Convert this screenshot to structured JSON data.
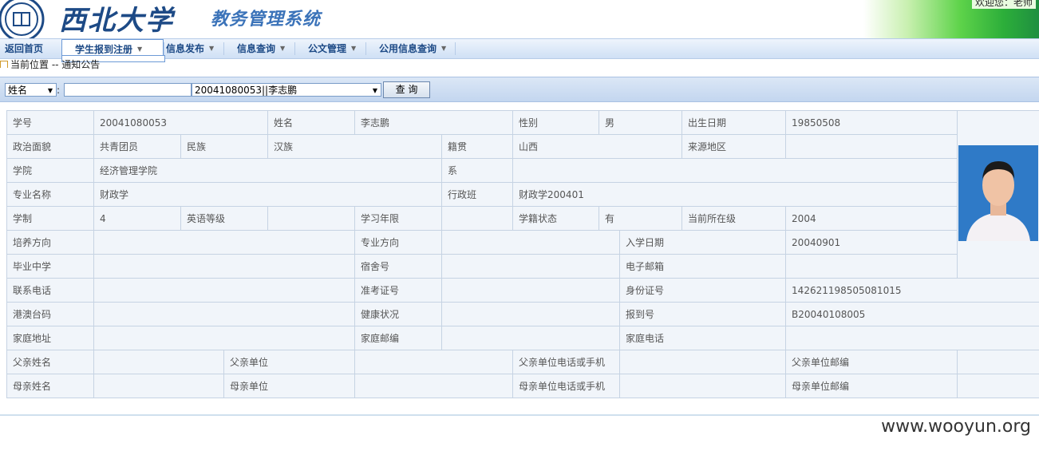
{
  "header": {
    "university": "西北大学",
    "system_title": "教务管理系统",
    "welcome": "欢迎您：老师"
  },
  "nav": {
    "items": [
      {
        "label": "返回首页",
        "dropdown": false
      },
      {
        "label": "学生报到注册",
        "dropdown": true,
        "active": true
      },
      {
        "label": "信息发布",
        "dropdown": true
      },
      {
        "label": "信息查询",
        "dropdown": true
      },
      {
        "label": "公文管理",
        "dropdown": true
      },
      {
        "label": "公用信息查询",
        "dropdown": true
      }
    ]
  },
  "breadcrumb": "当前位置 -- 通知公告",
  "search": {
    "field_select": "姓名",
    "colon": ":",
    "input_value": "",
    "result_select": "20041080053||李志鹏",
    "button_label": "查  询"
  },
  "student": {
    "labels": {
      "xh": "学号",
      "xm": "姓名",
      "xb": "性别",
      "csrq": "出生日期",
      "zzmm": "政治面貌",
      "mz": "民族",
      "jg": "籍贯",
      "lydq": "来源地区",
      "xy": "学院",
      "x": "系",
      "zymc": "专业名称",
      "xzb": "行政班",
      "xz": "学制",
      "yydj": "英语等级",
      "xxnx": "学习年限",
      "xjzt": "学籍状态",
      "dqszj": "当前所在级",
      "pyfx": "培养方向",
      "zyfx": "专业方向",
      "rxrq": "入学日期",
      "byzx": "毕业中学",
      "ssh": "宿舍号",
      "dzyx": "电子邮箱",
      "lxdh": "联系电话",
      "zkzh": "准考证号",
      "sfzh": "身份证号",
      "gatm": "港澳台码",
      "jkzk": "健康状况",
      "bdh": "报到号",
      "jtdz": "家庭地址",
      "jtyb": "家庭邮编",
      "jtdh": "家庭电话",
      "fqxm": "父亲姓名",
      "fqdw": "父亲单位",
      "fqdh": "父亲单位电话或手机",
      "fqyb": "父亲单位邮编",
      "mqxm": "母亲姓名",
      "mqdw": "母亲单位",
      "mqdh": "母亲单位电话或手机",
      "mqyb": "母亲单位邮编"
    },
    "values": {
      "xh": "20041080053",
      "xm": "李志鹏",
      "xb": "男",
      "csrq": "19850508",
      "zzmm": "共青团员",
      "mz": "汉族",
      "jg": "山西",
      "lydq": "",
      "xy": "经济管理学院",
      "x": "",
      "zymc": "财政学",
      "xzb": "财政学200401",
      "xz": "4",
      "yydj": "",
      "xxnx": "",
      "xjzt": "有",
      "dqszj": "2004",
      "pyfx": "",
      "zyfx": "",
      "rxrq": "20040901",
      "byzx": "",
      "ssh": "",
      "dzyx": "",
      "lxdh": "",
      "zkzh": "",
      "sfzh": "142621198505081015",
      "gatm": "",
      "jkzk": "",
      "bdh": "B20040108005",
      "jtdz": "",
      "jtyb": "",
      "jtdh": "",
      "fqxm": "",
      "fqdw": "",
      "fqdh": "",
      "fqyb": "",
      "mqxm": "",
      "mqdw": "",
      "mqdh": "",
      "mqyb": ""
    }
  },
  "watermark": "www.wooyun.org"
}
